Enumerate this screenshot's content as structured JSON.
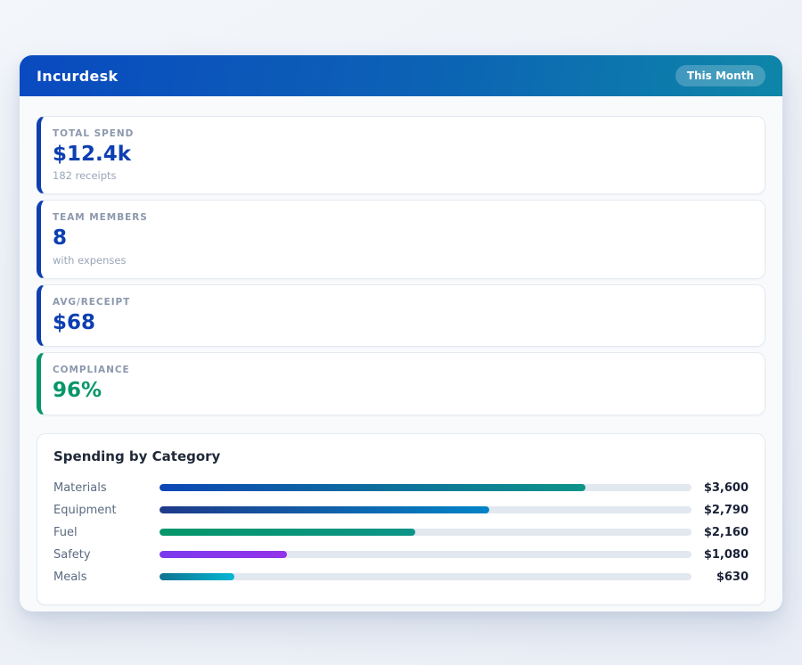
{
  "header": {
    "title": "Incurdesk",
    "badge": "This Month"
  },
  "stats": [
    {
      "label": "TOTAL SPEND",
      "value": "$12.4k",
      "sub": "182 receipts",
      "accent": "#0d3fb2",
      "value_color": "#0d3fb2"
    },
    {
      "label": "TEAM MEMBERS",
      "value": "8",
      "sub": "with expenses",
      "accent": "#0d3fb2",
      "value_color": "#0d3fb2"
    },
    {
      "label": "AVG/RECEIPT",
      "value": "$68",
      "sub": "",
      "accent": "#0d3fb2",
      "value_color": "#0d3fb2"
    },
    {
      "label": "COMPLIANCE",
      "value": "96%",
      "sub": "",
      "accent": "#059669",
      "value_color": "#059669"
    }
  ],
  "chart_data": {
    "type": "bar",
    "title": "Spending by Category",
    "orientation": "horizontal",
    "categories": [
      "Materials",
      "Equipment",
      "Fuel",
      "Safety",
      "Meals"
    ],
    "values": [
      3600,
      2790,
      2160,
      1080,
      630
    ],
    "value_labels": [
      "$3,600",
      "$2,790",
      "$2,160",
      "$1,080",
      "$630"
    ],
    "axis_max": 4500,
    "track_color": "#e2e8f0",
    "bar_gradients": [
      [
        "#0d47b5",
        "#0d9488"
      ],
      [
        "#1e3a8a",
        "#0284c7"
      ],
      [
        "#059669",
        "#0d9488"
      ],
      [
        "#7c3aed",
        "#9333ea"
      ],
      [
        "#0e7490",
        "#06b6d4"
      ]
    ]
  }
}
